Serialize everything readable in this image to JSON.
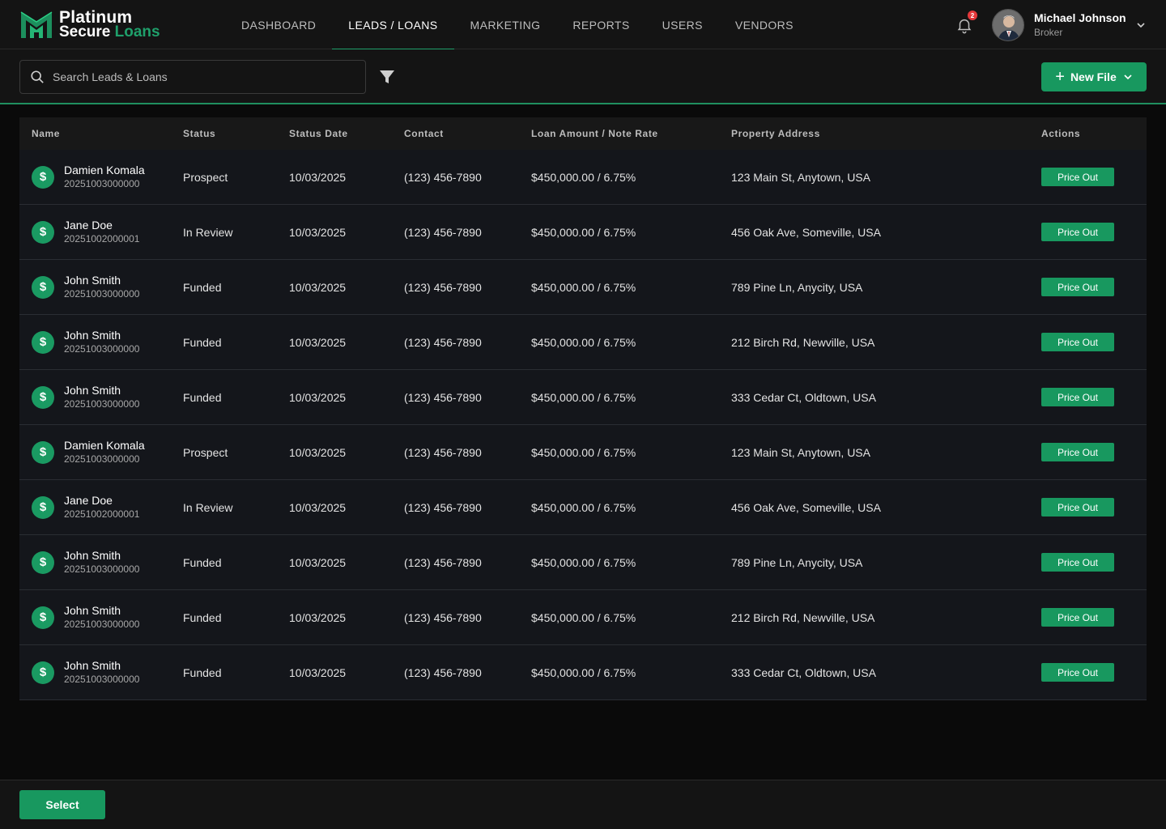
{
  "app": {
    "logo_line1": "Platinum",
    "logo_line2_a": "Secure",
    "logo_line2_b": "Loans",
    "brand_color": "#1fa06b"
  },
  "nav": {
    "items": [
      {
        "label": "DASHBOARD",
        "active": false
      },
      {
        "label": "LEADS / LOANS",
        "active": true
      },
      {
        "label": "MARKETING",
        "active": false
      },
      {
        "label": "REPORTS",
        "active": false
      },
      {
        "label": "USERS",
        "active": false
      },
      {
        "label": "VENDORS",
        "active": false
      }
    ]
  },
  "notifications": {
    "count": "2",
    "icon": "bell-icon"
  },
  "user": {
    "name": "Michael Johnson",
    "role": "Broker"
  },
  "toolbar": {
    "search_placeholder": "Search Leads & Loans",
    "new_file_label": "New File"
  },
  "table": {
    "headers": {
      "name": "Name",
      "status": "Status",
      "date": "Status Date",
      "contact": "Contact",
      "amount": "Loan Amount / Note Rate",
      "address": "Property Address",
      "actions": "Actions"
    },
    "action_label": "Price Out",
    "rows": [
      {
        "name": "Damien Komala",
        "id": "20251003000000",
        "status": "Prospect",
        "date": "10/03/2025",
        "contact": "(123) 456-7890",
        "amount": "$450,000.00 / 6.75%",
        "address": "123 Main St, Anytown, USA"
      },
      {
        "name": "Jane Doe",
        "id": "20251002000001",
        "status": "In Review",
        "date": "10/03/2025",
        "contact": "(123) 456-7890",
        "amount": "$450,000.00 / 6.75%",
        "address": "456 Oak Ave, Someville, USA"
      },
      {
        "name": "John Smith",
        "id": "20251003000000",
        "status": "Funded",
        "date": "10/03/2025",
        "contact": "(123) 456-7890",
        "amount": "$450,000.00 / 6.75%",
        "address": "789 Pine Ln, Anycity, USA"
      },
      {
        "name": "John Smith",
        "id": "20251003000000",
        "status": "Funded",
        "date": "10/03/2025",
        "contact": "(123) 456-7890",
        "amount": "$450,000.00 / 6.75%",
        "address": "212 Birch Rd, Newville, USA"
      },
      {
        "name": "John Smith",
        "id": "20251003000000",
        "status": "Funded",
        "date": "10/03/2025",
        "contact": "(123) 456-7890",
        "amount": "$450,000.00 / 6.75%",
        "address": "333 Cedar Ct, Oldtown, USA"
      },
      {
        "name": "Damien Komala",
        "id": "20251003000000",
        "status": "Prospect",
        "date": "10/03/2025",
        "contact": "(123) 456-7890",
        "amount": "$450,000.00 / 6.75%",
        "address": "123 Main St, Anytown, USA"
      },
      {
        "name": "Jane Doe",
        "id": "20251002000001",
        "status": "In Review",
        "date": "10/03/2025",
        "contact": "(123) 456-7890",
        "amount": "$450,000.00 / 6.75%",
        "address": "456 Oak Ave, Someville, USA"
      },
      {
        "name": "John Smith",
        "id": "20251003000000",
        "status": "Funded",
        "date": "10/03/2025",
        "contact": "(123) 456-7890",
        "amount": "$450,000.00 / 6.75%",
        "address": "789 Pine Ln, Anycity, USA"
      },
      {
        "name": "John Smith",
        "id": "20251003000000",
        "status": "Funded",
        "date": "10/03/2025",
        "contact": "(123) 456-7890",
        "amount": "$450,000.00 / 6.75%",
        "address": "212 Birch Rd, Newville, USA"
      },
      {
        "name": "John Smith",
        "id": "20251003000000",
        "status": "Funded",
        "date": "10/03/2025",
        "contact": "(123) 456-7890",
        "amount": "$450,000.00 / 6.75%",
        "address": "333 Cedar Ct, Oldtown, USA"
      }
    ]
  },
  "footer": {
    "select_label": "Select"
  }
}
